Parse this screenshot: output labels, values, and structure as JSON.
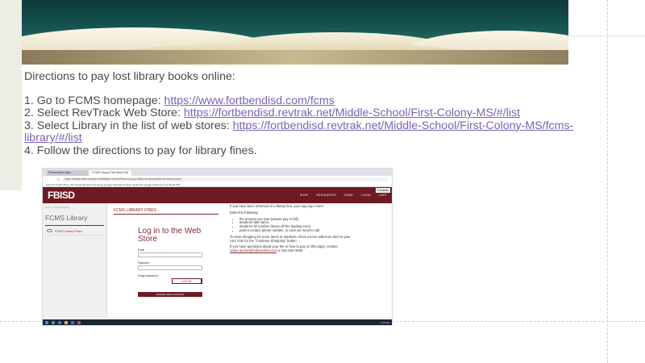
{
  "directions": {
    "intro": "Directions to pay lost library books online:",
    "steps": [
      {
        "prefix": "1. Go to FCMS homepage:  ",
        "link": "https://www.fortbendisd.com/fcms",
        "suffix": ""
      },
      {
        "prefix": "2. Select RevTrack Web Store: ",
        "link": "https://fortbendisd.revtrak.net/Middle-School/First-Colony-MS/#/list",
        "suffix": ""
      },
      {
        "prefix": "3. Select Library in the list of web stores: ",
        "link": "https://fortbendisd.revtrak.net/Middle-School/First-Colony-MS/fcms-library/#/list",
        "suffix": ""
      },
      {
        "prefix": "4. Follow the directions to pay for library fines.",
        "link": "",
        "suffix": ""
      }
    ]
  },
  "screenshot": {
    "tabs": [
      "Presentation login",
      "FCMS Library First Bend ISD"
    ],
    "url": "https://fortbendisd.revtrak.net/Middle-School/First-Colony-MS/fcms-library/#/fcms-library-fines",
    "bookmarks": "Apps   Fit   FCMS   Office Hub   Gmail   Skyward   Schoology   Google Calendar   Amazon   Textbooks   Google Classroom   Fort Bend ISD",
    "logo": "FBISD",
    "nav": [
      "SHOP",
      "RESOURCES",
      "HOME",
      "LOGIN",
      "CART"
    ],
    "translate": "Translate",
    "crumb": "Home > FCMS Library",
    "side_title": "FCMS Library",
    "side_item": "FCMS Library Fines",
    "fines_title": "FCMS LIBRARY FINES",
    "login_title": "Log in to the Web Store",
    "email_label": "Email",
    "password_label": "Password",
    "forgot_label": "Forgot password?",
    "login_button": "LOG IN",
    "create_button": "CREATE NEW ACCOUNT",
    "info_intro": "If you have been informed of a library fine, you may pay it here.",
    "info_enter": "Enter the following:",
    "info_items": [
      "the amount you owe (please pay in full),",
      "student's last name,",
      "student's ID number (leave off the leading zero)",
      "parent contact phone number, in case we need to call."
    ],
    "info_shopping": "To keep shopping for more items or students: Once you've added an item to your cart, look for the \"Continue Shopping\" button.",
    "info_questions": "If you have questions about your fee or how to pay on this page, contact",
    "info_email": "vickie.tacobs@fortbendisd.com",
    "info_phone": "or 281-634-3383.",
    "clock": "1:53 PM"
  },
  "colors": {
    "brand": "#6d1a22",
    "link": "#7a62b5",
    "text": "#4a4a4a"
  }
}
